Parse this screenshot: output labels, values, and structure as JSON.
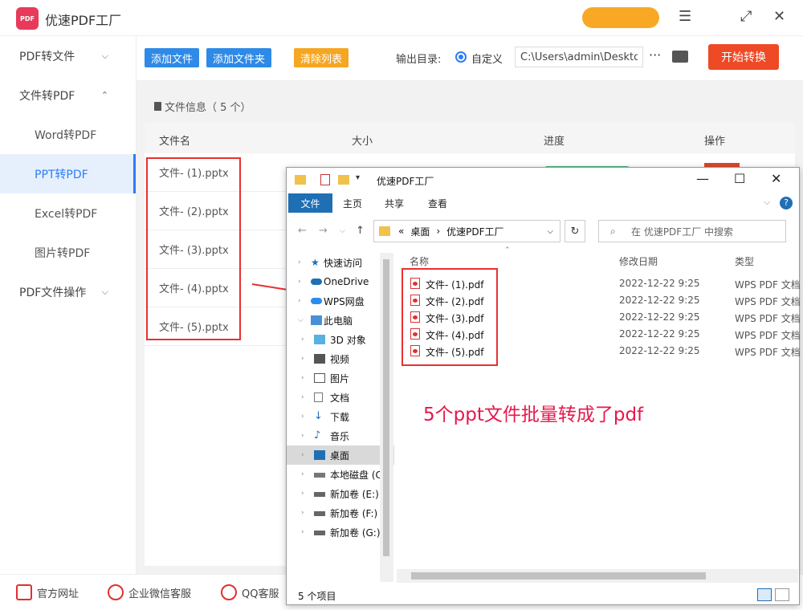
{
  "app": {
    "title": "优速PDF工厂",
    "logo_text": "PDF",
    "promo": ""
  },
  "sidebar": {
    "items": [
      {
        "label": "PDF转文件"
      },
      {
        "label": "文件转PDF"
      },
      {
        "label": "Word转PDF"
      },
      {
        "label": "PPT转PDF"
      },
      {
        "label": "Excel转PDF"
      },
      {
        "label": "图片转PDF"
      },
      {
        "label": "PDF文件操作"
      }
    ]
  },
  "toolbar": {
    "add_file": "添加文件",
    "add_folder": "添加文件夹",
    "clear_list": "清除列表",
    "output_label": "输出目录:",
    "custom_label": "自定义",
    "output_path": "C:\\Users\\admin\\Desktop",
    "more": "···",
    "start": "开始转换"
  },
  "file_list": {
    "info": "文件信息（ 5 个）",
    "columns": {
      "name": "文件名",
      "size": "大小",
      "progress": "进度",
      "action": "操作"
    },
    "rows": [
      "文件- (1).pptx",
      "文件- (2).pptx",
      "文件- (3).pptx",
      "文件- (4).pptx",
      "文件- (5).pptx"
    ]
  },
  "footer": {
    "website": "官方网址",
    "wechat": "企业微信客服",
    "qq": "QQ客服"
  },
  "explorer": {
    "title": "优速PDF工厂",
    "tabs": {
      "file": "文件",
      "home": "主页",
      "share": "共享",
      "view": "查看"
    },
    "address": {
      "root": "桌面",
      "folder": "优速PDF工厂",
      "prefix": "«"
    },
    "search_placeholder": "在 优速PDF工厂 中搜索",
    "tree": [
      {
        "label": "快速访问"
      },
      {
        "label": "OneDrive"
      },
      {
        "label": "WPS网盘"
      },
      {
        "label": "此电脑"
      },
      {
        "label": "3D 对象"
      },
      {
        "label": "视频"
      },
      {
        "label": "图片"
      },
      {
        "label": "文档"
      },
      {
        "label": "下载"
      },
      {
        "label": "音乐"
      },
      {
        "label": "桌面"
      },
      {
        "label": "本地磁盘 (C"
      },
      {
        "label": "新加卷 (E:)"
      },
      {
        "label": "新加卷 (F:)"
      },
      {
        "label": "新加卷 (G:)"
      }
    ],
    "columns": {
      "name": "名称",
      "date": "修改日期",
      "type": "类型"
    },
    "files": [
      {
        "name": "文件- (1).pdf",
        "date": "2022-12-22 9:25",
        "type": "WPS PDF 文档"
      },
      {
        "name": "文件- (2).pdf",
        "date": "2022-12-22 9:25",
        "type": "WPS PDF 文档"
      },
      {
        "name": "文件- (3).pdf",
        "date": "2022-12-22 9:25",
        "type": "WPS PDF 文档"
      },
      {
        "name": "文件- (4).pdf",
        "date": "2022-12-22 9:25",
        "type": "WPS PDF 文档"
      },
      {
        "name": "文件- (5).pdf",
        "date": "2022-12-22 9:25",
        "type": "WPS PDF 文档"
      }
    ],
    "status": "5 个项目"
  },
  "annotation": "5个ppt文件批量转成了pdf",
  "colors": {
    "accent_blue": "#2e7cf6",
    "start_red": "#ee4a25",
    "annotation_red": "#e8174a"
  }
}
